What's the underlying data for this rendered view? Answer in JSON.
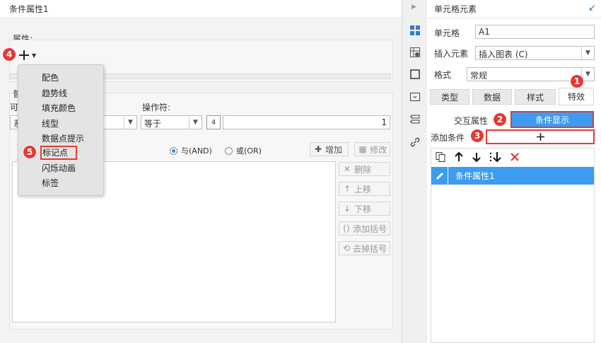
{
  "dialog": {
    "title": "条件属性1",
    "property_label": "属性:",
    "group2_label_a": "普",
    "group2_label_b": "可",
    "group2_value_stub": "系",
    "operator_label": "操作符:",
    "operator_value": "等于",
    "operand_value": "1",
    "num_icon_text": "4",
    "radio_and": "与(AND)",
    "radio_or": "或(OR)",
    "add_button": "增加",
    "modify_button": "修改",
    "delete_button": "删除",
    "up_button": "上移",
    "down_button": "下移",
    "add_bracket_button": "添加括号",
    "remove_bracket_button": "去掉括号"
  },
  "dropdown_menu": {
    "items": [
      "配色",
      "趋势线",
      "填充颜色",
      "线型",
      "数据点提示",
      "标记点",
      "闪烁动画",
      "标签"
    ],
    "highlighted": "标记点"
  },
  "right_panel": {
    "title": "单元格元素",
    "cell_label": "单元格",
    "cell_value": "A1",
    "insert_label": "插入元素",
    "insert_value": "插入图表 (C)",
    "format_label": "格式",
    "format_value": "常规",
    "tabs": [
      "类型",
      "数据",
      "样式",
      "特效"
    ],
    "active_tab": "特效",
    "sub_tabs": [
      "交互属性",
      "条件显示"
    ],
    "add_condition_label": "添加条件",
    "condition_item": "条件属性1"
  },
  "badges": [
    "1",
    "2",
    "3",
    "4",
    "5"
  ],
  "colors": {
    "accent_blue": "#3d9cf0",
    "highlight_red": "#e53935",
    "delete_red": "#e53935"
  }
}
